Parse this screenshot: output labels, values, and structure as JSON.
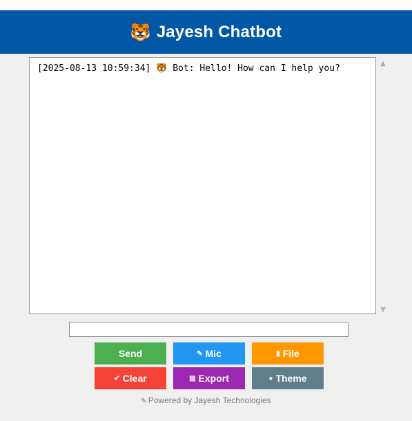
{
  "header": {
    "logo_icon": "🐯",
    "title": "Jayesh Chatbot",
    "color": "#0057a6"
  },
  "chat": {
    "messages": [
      {
        "timestamp": "[2025-08-13 10:59:34]",
        "icon": "🐯",
        "sender": "Bot",
        "text": "Hello! How can I help you?"
      }
    ]
  },
  "input": {
    "value": "",
    "placeholder": ""
  },
  "buttons": {
    "send": {
      "label": "Send",
      "icon": "",
      "color": "#4caf50"
    },
    "mic": {
      "label": "Mic",
      "icon": "✎",
      "color": "#2196f3"
    },
    "file": {
      "label": "File",
      "icon": "▮",
      "color": "#ff9800"
    },
    "clear": {
      "label": "Clear",
      "icon": "✔",
      "color": "#f44336"
    },
    "export": {
      "label": "Export",
      "icon": "▤",
      "color": "#9c27b0"
    },
    "theme": {
      "label": "Theme",
      "icon": "●",
      "color": "#607d8b"
    }
  },
  "footer": {
    "icon": "✎",
    "text": "Powered by Jayesh Technologies"
  }
}
